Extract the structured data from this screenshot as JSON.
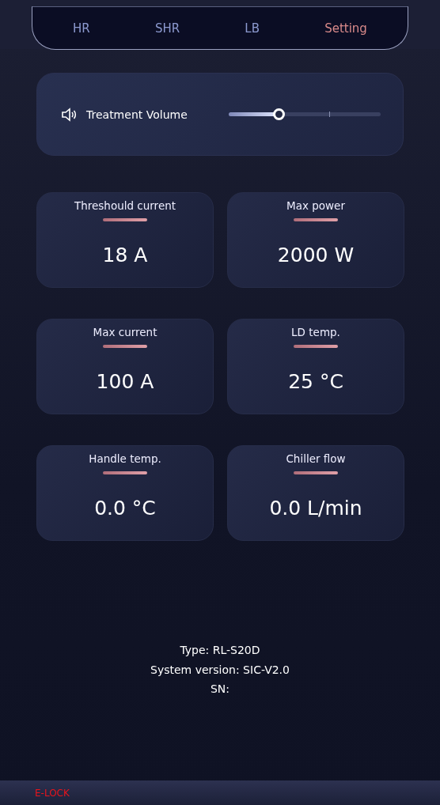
{
  "tabs": [
    {
      "label": "HR",
      "selected": false
    },
    {
      "label": "SHR",
      "selected": false
    },
    {
      "label": "LB",
      "selected": false
    },
    {
      "label": "Setting",
      "selected": true
    }
  ],
  "volume": {
    "label": "Treatment Volume",
    "level": 0.33
  },
  "metrics": [
    {
      "label": "Threshould current",
      "value": "18 A"
    },
    {
      "label": "Max power",
      "value": "2000 W"
    },
    {
      "label": "Max current",
      "value": "100 A"
    },
    {
      "label": "LD temp.",
      "value": "25 °C"
    },
    {
      "label": "Handle temp.",
      "value": "0.0 °C"
    },
    {
      "label": "Chiller flow",
      "value": "0.0 L/min"
    }
  ],
  "info": [
    "Type: RL-S20D",
    "System version: SIC-V2.0",
    "SN:"
  ],
  "status_bar": {
    "label": "E-LOCK"
  }
}
